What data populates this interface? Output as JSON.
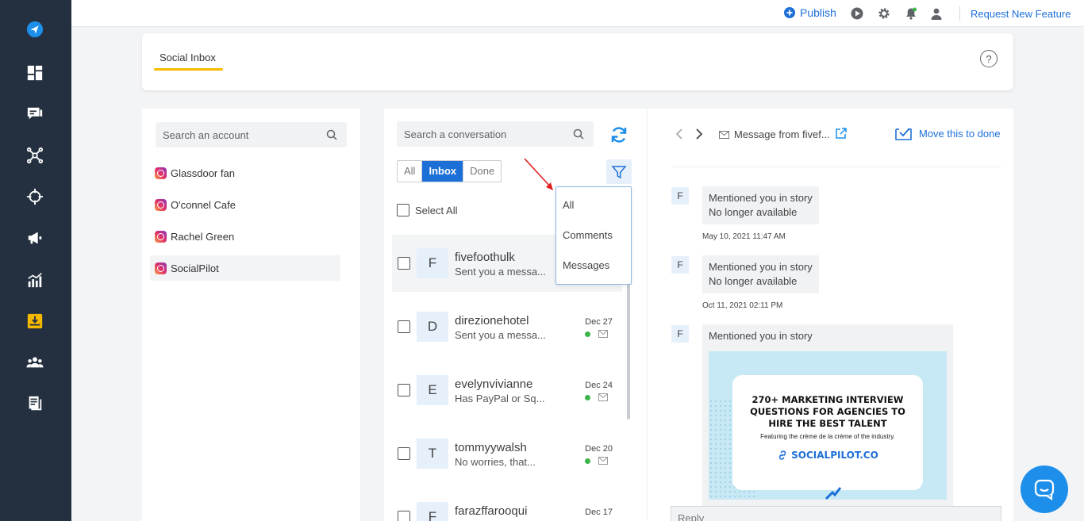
{
  "sidebar": {
    "icons": [
      "logo-icon",
      "dashboard-icon",
      "compose-icon",
      "connect-icon",
      "target-icon",
      "megaphone-icon",
      "analytics-icon",
      "inbox-icon",
      "team-icon",
      "content-library-icon"
    ],
    "background": "#24303f",
    "active_color": "#f6b900"
  },
  "topbar": {
    "publish_label": "Publish",
    "request_label": "Request New Feature",
    "accent": "#1d6fd8"
  },
  "tabs": {
    "social_inbox": "Social Inbox",
    "help": "?"
  },
  "accounts": {
    "search_placeholder": "Search an account",
    "items": [
      {
        "name": "Glassdoor fan"
      },
      {
        "name": "O'connel Cafe"
      },
      {
        "name": "Rachel Green"
      },
      {
        "name": "SocialPilot"
      }
    ]
  },
  "conversations": {
    "search_placeholder": "Search a conversation",
    "segments": [
      "All",
      "Inbox",
      "Done"
    ],
    "active_segment": "Inbox",
    "select_all": "Select All",
    "filter_options": [
      "All",
      "Comments",
      "Messages"
    ],
    "items": [
      {
        "initial": "F",
        "name": "fivefoothulk",
        "preview": "Sent you a messa...",
        "date": ""
      },
      {
        "initial": "D",
        "name": "direzionehotel",
        "preview": "Sent you a messa...",
        "date": "Dec 27"
      },
      {
        "initial": "E",
        "name": "evelynvivianne",
        "preview": "Has PayPal or Sq...",
        "date": "Dec 24"
      },
      {
        "initial": "T",
        "name": "tommyywalsh",
        "preview": "No worries, that...",
        "date": "Dec 20"
      },
      {
        "initial": "F",
        "name": "farazffarooqui",
        "preview": "",
        "date": "Dec 17"
      }
    ]
  },
  "message": {
    "from_label": "Message from fivef...",
    "move_done_label": "Move this to done",
    "reply_placeholder": "Reply",
    "thread": [
      {
        "initial": "F",
        "line1": "Mentioned you in story",
        "line2": "No longer available",
        "time": "May 10, 2021 11:47 AM"
      },
      {
        "initial": "F",
        "line1": "Mentioned you in story",
        "line2": "No longer available",
        "time": "Oct 11, 2021 02:11 PM"
      },
      {
        "initial": "F",
        "line1": "Mentioned you in story",
        "line2": "",
        "time": ""
      }
    ],
    "story_image": {
      "title": "270+ MARKETING INTERVIEW QUESTIONS FOR AGENCIES TO HIRE THE BEST TALENT",
      "subtitle": "Featuring the crème de la crème of the industry.",
      "logo": "SOCIALPILOT.CO"
    }
  }
}
